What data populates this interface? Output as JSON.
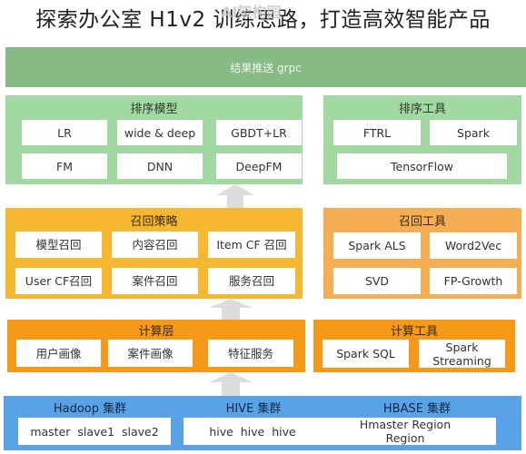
{
  "title": "探索办公室 H1v2 训练思路，打造高效智能产品",
  "watermark": "AI架构园",
  "banner": {
    "label": "结果推送 grpc"
  },
  "ranking_model": {
    "title": "排序模型",
    "items": [
      "LR",
      "wide & deep",
      "GBDT+LR",
      "FM",
      "DNN",
      "DeepFM"
    ]
  },
  "ranking_tools": {
    "title": "排序工具",
    "items": [
      "FTRL",
      "Spark",
      "TensorFlow"
    ]
  },
  "recall_strategy": {
    "title": "召回策略",
    "items": [
      "模型召回",
      "内容召回",
      "Item CF 召回",
      "User CF召回",
      "案件召回",
      "服务召回"
    ]
  },
  "recall_tools": {
    "title": "召回工具",
    "items": [
      "Spark ALS",
      "Word2Vec",
      "SVD",
      "FP-Growth"
    ]
  },
  "compute_layer": {
    "title": "计算层",
    "items": [
      "用户画像",
      "案件画像",
      "特征服务"
    ]
  },
  "compute_tools": {
    "title": "计算工具",
    "items": [
      "Spark SQL",
      "Spark Streaming"
    ]
  },
  "clusters": [
    {
      "title": "Hadoop 集群",
      "content": "master  slave1  slave2"
    },
    {
      "title": "HIVE 集群",
      "content": "hive  hive  hive"
    },
    {
      "title": "HBASE 集群",
      "content": "Hmaster  Region Region"
    }
  ],
  "colors": {
    "banner": "#86bb86",
    "ranking": "#a2d8a2",
    "recall_strategy": "#f6b830",
    "recall_tools": "#f6ae54",
    "compute": "#f59a18",
    "storage": "#5aa2e6"
  }
}
